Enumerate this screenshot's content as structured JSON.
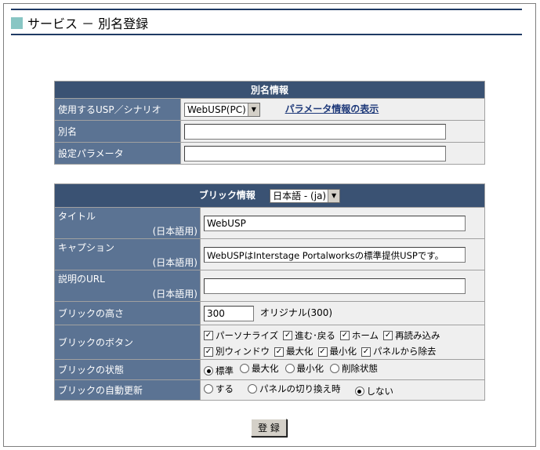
{
  "page": {
    "title": "サービス － 別名登録"
  },
  "alias_section": {
    "header": "別名情報",
    "usp_label": "使用するUSP／シナリオ",
    "usp_select_value": "WebUSP(PC)",
    "param_link": "パラメータ情報の表示",
    "alias_label": "別名",
    "alias_value": "",
    "param_label": "設定パラメータ",
    "param_value": ""
  },
  "brick_section": {
    "header": "ブリック情報",
    "lang_select_value": "日本語 - (ja)",
    "title_label": "タイトル",
    "title_sub": "(日本語用)",
    "title_value": "WebUSP",
    "caption_label": "キャプション",
    "caption_sub": "(日本語用)",
    "caption_value": "WebUSPはInterstage Portalworksの標準提供USPです。",
    "url_label": "説明のURL",
    "url_sub": "(日本語用)",
    "url_value": "",
    "height_label": "ブリックの高さ",
    "height_value": "300",
    "height_original": "オリジナル(300)",
    "buttons_label": "ブリックのボタン",
    "buttons": [
      {
        "label": "パーソナライズ",
        "checked": true
      },
      {
        "label": "進む･戻る",
        "checked": true
      },
      {
        "label": "ホーム",
        "checked": true
      },
      {
        "label": "再読み込み",
        "checked": true
      },
      {
        "label": "別ウィンドウ",
        "checked": true
      },
      {
        "label": "最大化",
        "checked": true
      },
      {
        "label": "最小化",
        "checked": true
      },
      {
        "label": "パネルから除去",
        "checked": true
      }
    ],
    "state_label": "ブリックの状態",
    "states": [
      {
        "label": "標準",
        "selected": true
      },
      {
        "label": "最大化",
        "selected": false
      },
      {
        "label": "最小化",
        "selected": false
      },
      {
        "label": "削除状態",
        "selected": false
      }
    ],
    "refresh_label": "ブリックの自動更新",
    "refresh_options": [
      {
        "label": "する",
        "selected": false
      },
      {
        "label": "パネルの切り換え時",
        "selected": false
      },
      {
        "label": "しない",
        "selected": true
      }
    ]
  },
  "submit": {
    "label": "登 録"
  }
}
